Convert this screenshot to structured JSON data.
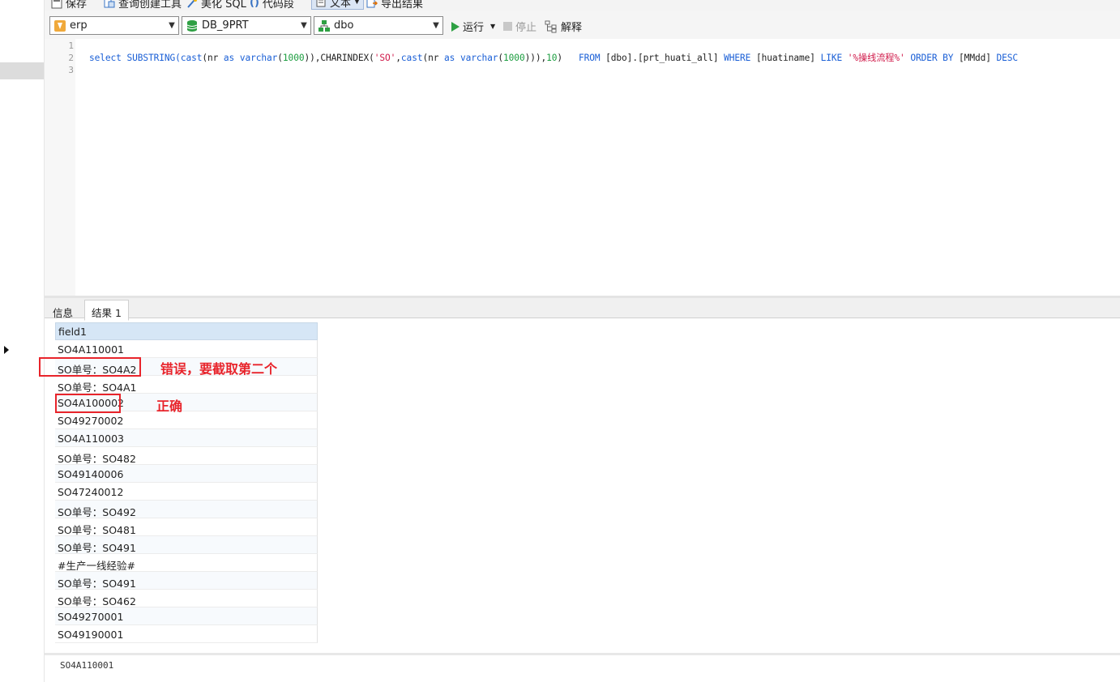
{
  "top_toolbar": {
    "save_label": "保存",
    "query_builder_label": "查询创建工具",
    "beautify_label": "美化 SQL",
    "snippet_label": "代码段",
    "text_label": "文本",
    "export_label": "导出结果"
  },
  "toolbar": {
    "connection": "erp",
    "database": "DB_9PRT",
    "schema": "dbo",
    "run_label": "运行",
    "stop_label": "停止",
    "explain_label": "解释"
  },
  "editor": {
    "line_numbers": [
      "1",
      "2",
      "3"
    ],
    "sql_tokens": [
      {
        "t": "select SUBSTRING(",
        "c": "kw"
      },
      {
        "t": "cast",
        "c": "kw"
      },
      {
        "t": "(nr ",
        "c": ""
      },
      {
        "t": "as",
        "c": "kw"
      },
      {
        "t": " ",
        "c": ""
      },
      {
        "t": "varchar",
        "c": "kw"
      },
      {
        "t": "(",
        "c": ""
      },
      {
        "t": "1000",
        "c": "num"
      },
      {
        "t": ")),CHARINDEX(",
        "c": ""
      },
      {
        "t": "'SO'",
        "c": "str"
      },
      {
        "t": ",",
        "c": ""
      },
      {
        "t": "cast",
        "c": "kw"
      },
      {
        "t": "(nr ",
        "c": ""
      },
      {
        "t": "as",
        "c": "kw"
      },
      {
        "t": " ",
        "c": ""
      },
      {
        "t": "varchar",
        "c": "kw"
      },
      {
        "t": "(",
        "c": ""
      },
      {
        "t": "1000",
        "c": "num"
      },
      {
        "t": "))),",
        "c": ""
      },
      {
        "t": "10",
        "c": "num"
      },
      {
        "t": ")   ",
        "c": ""
      },
      {
        "t": "FROM",
        "c": "kw"
      },
      {
        "t": " [dbo].[prt_huati_all] ",
        "c": ""
      },
      {
        "t": "WHERE",
        "c": "kw"
      },
      {
        "t": " [huatiname] ",
        "c": ""
      },
      {
        "t": "LIKE",
        "c": "kw"
      },
      {
        "t": " ",
        "c": ""
      },
      {
        "t": "'%操线流程%'",
        "c": "str"
      },
      {
        "t": " ",
        "c": ""
      },
      {
        "t": "ORDER BY",
        "c": "kw"
      },
      {
        "t": " [MMdd] ",
        "c": ""
      },
      {
        "t": "DESC",
        "c": "kw"
      }
    ]
  },
  "result_tabs": [
    "信息",
    "结果 1"
  ],
  "grid": {
    "column": "field1",
    "rows": [
      "SO4A110001",
      "SO单号：SO4A2",
      "SO单号：SO4A1",
      "SO4A100002",
      "SO49270002",
      "SO4A110003",
      "SO单号：SO482",
      "SO49140006",
      "SO47240012",
      "SO单号：SO492",
      "SO单号：SO481",
      "SO单号：SO491",
      "#生产一线经验#",
      "SO单号：SO491",
      "SO单号：SO462",
      "SO49270001",
      "SO49190001"
    ]
  },
  "annotations": {
    "wrong": "错误，要截取第二个",
    "correct": "正确"
  },
  "status": {
    "value": "SO4A110001"
  },
  "colors": {
    "annotation_red": "#e8242b",
    "keyword_blue": "#1a5fd6",
    "string_red": "#d01a4a",
    "number_green": "#1a9c3e",
    "header_blue": "#d6e6f6"
  }
}
